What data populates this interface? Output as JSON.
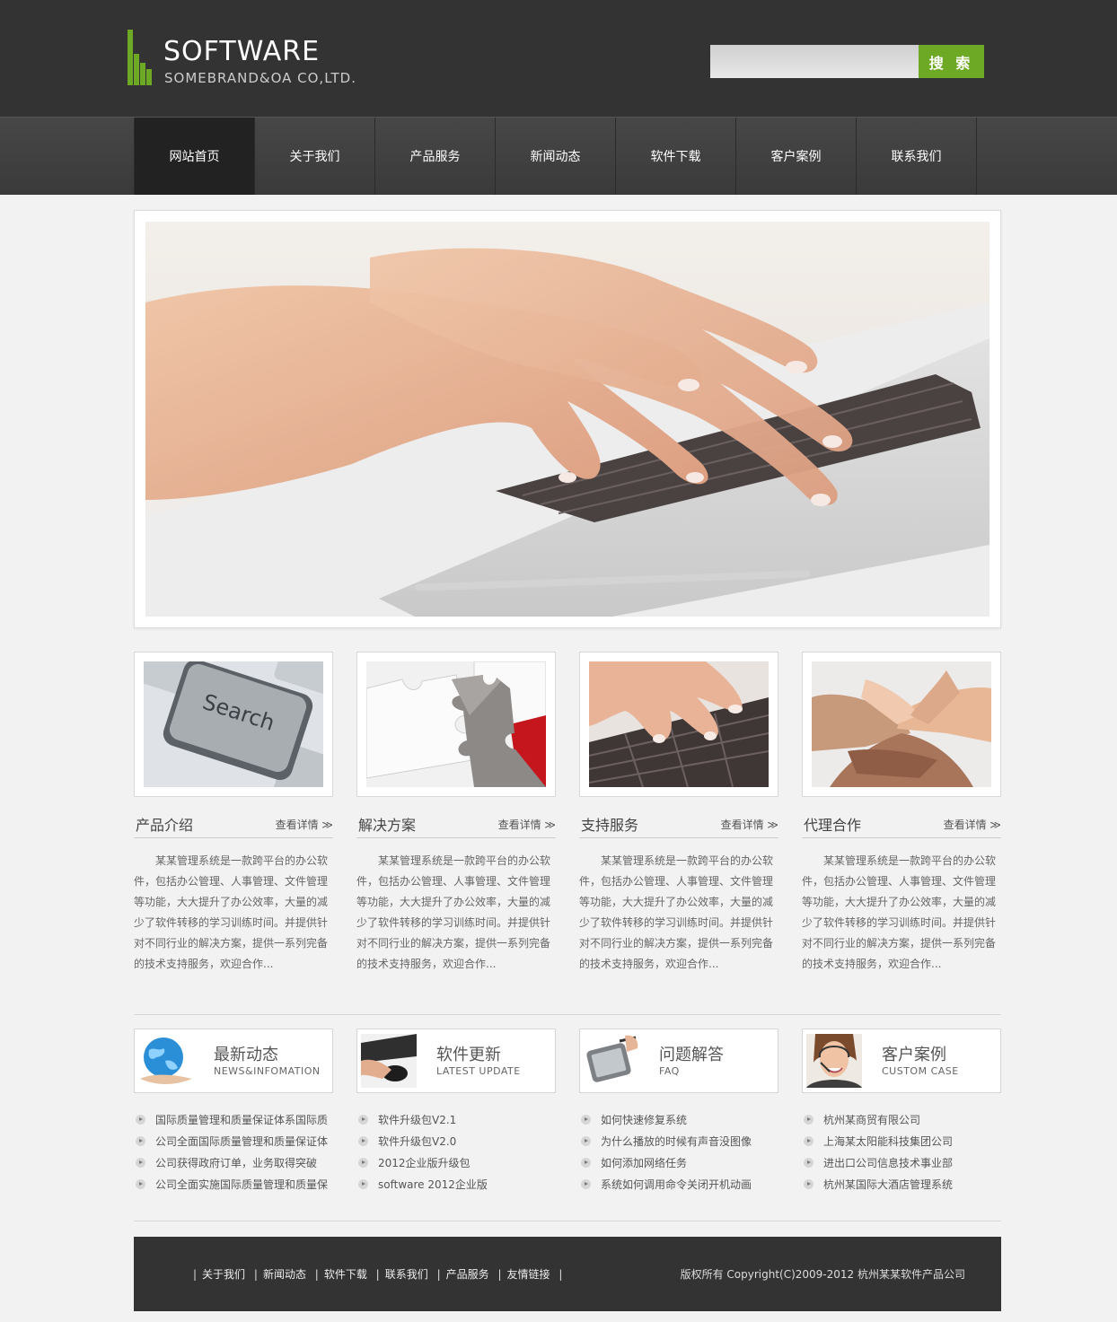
{
  "header": {
    "logo_title": "SOFTWARE",
    "logo_subtitle": "SOMEBRAND&OA CO,LTD.",
    "search_placeholder": "",
    "search_button": "搜 索"
  },
  "nav": {
    "items": [
      {
        "label": "网站首页",
        "active": true
      },
      {
        "label": "关于我们"
      },
      {
        "label": "产品服务"
      },
      {
        "label": "新闻动态"
      },
      {
        "label": "软件下载"
      },
      {
        "label": "客户案例"
      },
      {
        "label": "联系我们"
      }
    ]
  },
  "features": [
    {
      "title": "产品介绍",
      "more": "查看详情 ≫",
      "image": "search-key-image",
      "desc": "某某管理系统是一款跨平台的办公软件，包括办公管理、人事管理、文件管理等功能，大大提升了办公效率，大量的减少了软件转移的学习训练时间。并提供针对不同行业的解决方案，提供一系列完备的技术支持服务，欢迎合作..."
    },
    {
      "title": "解决方案",
      "more": "查看详情 ≫",
      "image": "puzzle-image",
      "desc": "某某管理系统是一款跨平台的办公软件，包括办公管理、人事管理、文件管理等功能，大大提升了办公效率，大量的减少了软件转移的学习训练时间。并提供针对不同行业的解决方案，提供一系列完备的技术支持服务，欢迎合作..."
    },
    {
      "title": "支持服务",
      "more": "查看详情 ≫",
      "image": "typing-image",
      "desc": "某某管理系统是一款跨平台的办公软件，包括办公管理、人事管理、文件管理等功能，大大提升了办公效率，大量的减少了软件转移的学习训练时间。并提供针对不同行业的解决方案，提供一系列完备的技术支持服务，欢迎合作..."
    },
    {
      "title": "代理合作",
      "more": "查看详情 ≫",
      "image": "hands-image",
      "desc": "某某管理系统是一款跨平台的办公软件，包括办公管理、人事管理、文件管理等功能，大大提升了办公效率，大量的减少了软件转移的学习训练时间。并提供针对不同行业的解决方案，提供一系列完备的技术支持服务，欢迎合作..."
    }
  ],
  "info": [
    {
      "title_cn": "最新动态",
      "title_en": "NEWS&INFOMATION",
      "icon": "globe-icon",
      "items": [
        "国际质量管理和质量保证体系国际质",
        "公司全面国际质量管理和质量保证体",
        "公司获得政府订单，业务取得突破",
        "公司全面实施国际质量管理和质量保"
      ]
    },
    {
      "title_cn": "软件更新",
      "title_en": "LATEST UPDATE",
      "icon": "mouse-icon",
      "items": [
        "软件升级包V2.1",
        "软件升级包V2.0",
        "2012企业版升级包",
        "software 2012企业版"
      ]
    },
    {
      "title_cn": "问题解答",
      "title_en": "FAQ",
      "icon": "tablet-pen-icon",
      "items": [
        "如何快速修复系统",
        "为什么播放的时候有声音没图像",
        "如何添加网络任务",
        "系统如何调用命令关闭开机动画"
      ]
    },
    {
      "title_cn": "客户案例",
      "title_en": "CUSTOM CASE",
      "icon": "headset-agent-icon",
      "items": [
        "杭州某商贸有限公司",
        "上海某太阳能科技集团公司",
        "进出口公司信息技术事业部",
        "杭州某国际大酒店管理系统"
      ]
    }
  ],
  "footer": {
    "links": [
      "关于我们",
      "新闻动态",
      "软件下载",
      "联系我们",
      "产品服务",
      "友情链接"
    ],
    "copyright": "版权所有 Copyright(C)2009-2012 杭州某某软件产品公司"
  },
  "colors": {
    "accent": "#6ea926",
    "header_bg": "#333333",
    "nav_bg": "#3f3f3f",
    "active_nav": "#222222"
  }
}
